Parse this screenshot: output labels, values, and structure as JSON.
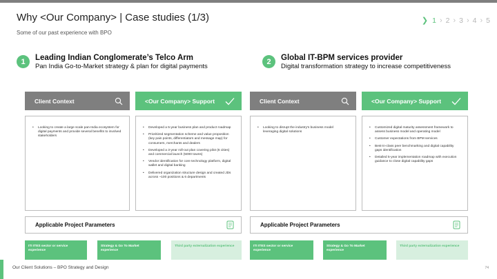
{
  "header": {
    "title": "Why <Our Company> | Case studies (1/3)",
    "subtitle": "Some of our past experience with BPO",
    "pager": [
      "1",
      "2",
      "3",
      "4",
      "5"
    ]
  },
  "cases": [
    {
      "number": "1",
      "name": "Leading Indian Conglomerate’s Telco Arm",
      "description": "Pan India Go-to-Market strategy & plan for digital payments",
      "client_context_label": "Client Context",
      "support_label": "<Our Company> Support",
      "client_context_items": [
        "Looking to create a large scale pan-India ecosystem for digital payments and provide several benefits to involved stakeholders"
      ],
      "support_items": [
        "Developed a 5-year business plan and  product roadmap",
        "Prioritized segmentation scheme and value proposition (key pain points, differentiators and message map) for consumers, merchants and dealers",
        "Developed a 3-year roll-out plan covering pilot (6 cities) and commercial launch (5000 towns)",
        "Vendor identification for core technology platform, digital wallet and digital banking",
        "Delivered organization structure design and created JDs across ~100 positions & 6 departments"
      ],
      "params_label": "Applicable Project Parameters",
      "tags": [
        "ITI ITES sector or service experience",
        "Strategy & Go To Market experience",
        "Third party externalization experience"
      ]
    },
    {
      "number": "2",
      "name": "Global IT-BPM services provider",
      "description": "Digital transformation strategy to increase competitiveness",
      "client_context_label": "Client Context",
      "support_label": "<Our Company> Support",
      "client_context_items": [
        "Looking to disrupt the industry's business model leveraging digital solutions"
      ],
      "support_items": [
        "Customized digital maturity assessment framework to assess business model and operating model",
        "Customer expectations from BPM services",
        "Best-in-class peer benchmarking and digital capability gaps identification",
        "Detailed 5-year implementation roadmap with execution guidance to close digital capability gaps"
      ],
      "params_label": "Applicable Project Parameters",
      "tags": [
        "ITI ITES sector or service experience",
        "Strategy & Go To Market experience",
        "Third party externalization experience"
      ]
    }
  ],
  "footer": {
    "text": "Our Client Solutions – BPO Strategy and Design",
    "page_number": "74"
  },
  "colors": {
    "accent": "#5cc27d",
    "accent_light": "#d7efdf",
    "grey_bar": "#7f7f7f"
  },
  "icons": [
    "chevron-right-icon",
    "magnifier-icon",
    "checkmark-icon",
    "document-icon"
  ]
}
